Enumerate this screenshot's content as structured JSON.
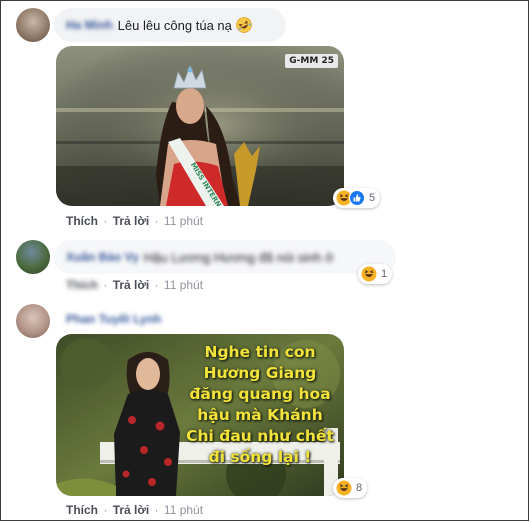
{
  "comments": [
    {
      "author": "Ha Minh",
      "text": "Lêu lêu công túa nạ",
      "emoji_icon": "rolling-on-floor-laughing",
      "image": {
        "banner_text": "MISS INTERN",
        "logo_text": "G-MM 25"
      },
      "reaction_count": "5",
      "reaction_icons": [
        "haha-icon",
        "like-icon"
      ],
      "actions": {
        "like": "Thích",
        "reply": "Trả lời",
        "time": "11 phút"
      }
    },
    {
      "author": "Xuân Bảo Vy",
      "text": "Hậu Lương Hương đã nói sinh ở",
      "reaction_count": "1",
      "reaction_icons": [
        "haha-icon"
      ],
      "actions": {
        "like": "Thích",
        "reply": "Trả lời",
        "time": "11 phút"
      }
    },
    {
      "author": "Phan Tuyết Lynh",
      "image": {
        "overlay_text": "Nghe tin con Hương Giang đăng quang hoa hậu mà Khánh Chi đau như chết đi sống lại !"
      },
      "reaction_count": "8",
      "reaction_icons": [
        "haha-icon"
      ],
      "actions": {
        "like": "Thích",
        "reply": "Trả lời",
        "time": "11 phút"
      }
    }
  ],
  "colors": {
    "link": "#385898",
    "bubble": "#f2f3f5",
    "haha": "#f7b125",
    "like": "#1877f2",
    "meta": "#90949c"
  }
}
